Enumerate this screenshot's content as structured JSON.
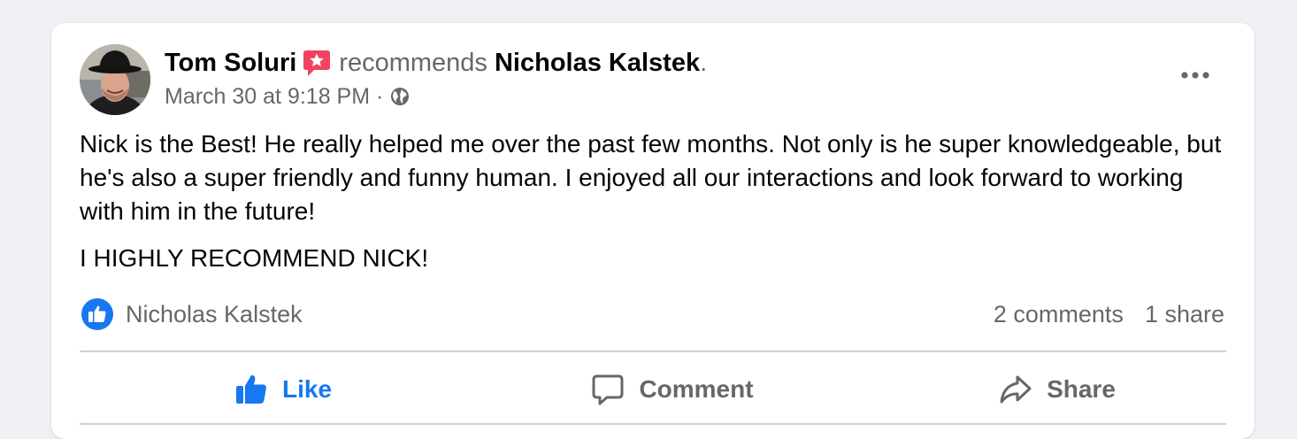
{
  "post": {
    "author": "Tom Soluri",
    "badge_icon": "recommendation-star-icon",
    "action_text": "recommends",
    "recommended_page": "Nicholas Kalstek",
    "period": ".",
    "timestamp": "March 30 at 9:18 PM",
    "separator": "·",
    "audience_icon": "globe-icon",
    "body": [
      "Nick is the Best! He really helped me over the past few months. Not only is he super knowledgeable, but he's also a super friendly and funny human. I enjoyed all our interactions and look forward to working with him in the future!",
      "I HIGHLY RECOMMEND NICK!"
    ]
  },
  "stats": {
    "reaction_icon": "like-reaction-icon",
    "reactor": "Nicholas Kalstek",
    "comments": "2 comments",
    "shares": "1 share"
  },
  "actions": {
    "like": "Like",
    "comment": "Comment",
    "share": "Share"
  },
  "colors": {
    "accent": "#1877f2",
    "secondary_text": "#65676b",
    "primary_text": "#050505",
    "badge": "#f3425f",
    "background": "#eff0f3"
  }
}
